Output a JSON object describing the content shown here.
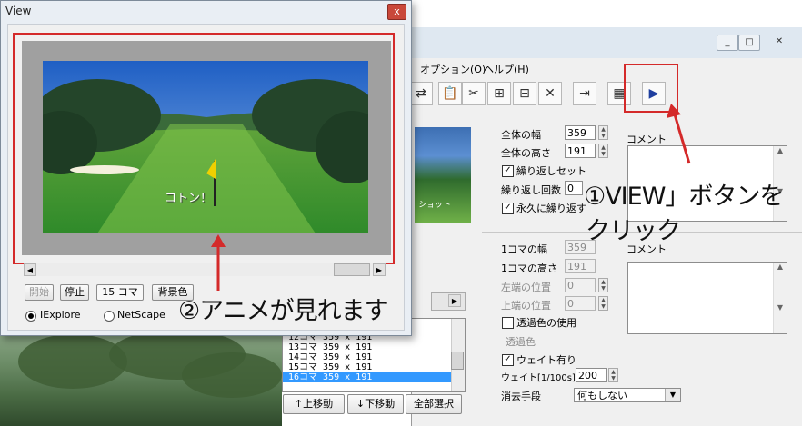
{
  "view_window": {
    "title": "View",
    "close_label": "x",
    "scene_caption": "コトン！",
    "buttons": {
      "start": "開始",
      "stop": "停止",
      "frames": "15 コマ",
      "bgcolor": "背景色"
    },
    "radios": [
      {
        "label": "IExplore",
        "checked": true
      },
      {
        "label": "NetScape",
        "checked": false
      }
    ]
  },
  "main_window": {
    "window_buttons": [
      "_",
      "□",
      "✕"
    ],
    "menus": [
      "オプション(O)",
      "ヘルプ(H)"
    ],
    "thumb_caption": "ショット",
    "frame_list": [
      {
        "text": "12コマ  359 x 191",
        "selected": false
      },
      {
        "text": "13コマ  359 x 191",
        "selected": false
      },
      {
        "text": "14コマ  359 x 191",
        "selected": false
      },
      {
        "text": "15コマ  359 x 191",
        "selected": false
      },
      {
        "text": "16コマ  359 x 191",
        "selected": true
      }
    ],
    "list_buttons": {
      "up": "↑上移動",
      "down": "↓下移動",
      "select_all": "全部選択"
    },
    "global": {
      "width_label": "全体の幅",
      "width_value": "359",
      "height_label": "全体の高さ",
      "height_value": "191",
      "comment_label": "コメント",
      "loop_set_label": "繰り返しセット",
      "loop_count_label": "繰り返し回数",
      "loop_count_value": "0",
      "loop_forever_label": "永久に繰り返す"
    },
    "frame": {
      "width_label": "1コマの幅",
      "width_value": "359",
      "height_label": "1コマの高さ",
      "height_value": "191",
      "comment_label": "コメント",
      "left_label": "左端の位置",
      "left_value": "0",
      "top_label": "上端の位置",
      "top_value": "0",
      "transparent_label": "透過色の使用",
      "transparent_color_label": "透過色",
      "wait_label": "ウェイト有り",
      "wait_time_label": "ウェイト[1/100s]",
      "wait_time_value": "200",
      "dispose_label": "消去手段",
      "dispose_value": "何もしない"
    }
  },
  "annotations": {
    "step1_line1": "①VIEW」ボタンを",
    "step1_line2": "クリック",
    "step2": "②アニメが見れます"
  },
  "colors": {
    "annotation_red": "#d42a2a",
    "selection_blue": "#3399ff",
    "play_blue": "#1f3f9f"
  }
}
